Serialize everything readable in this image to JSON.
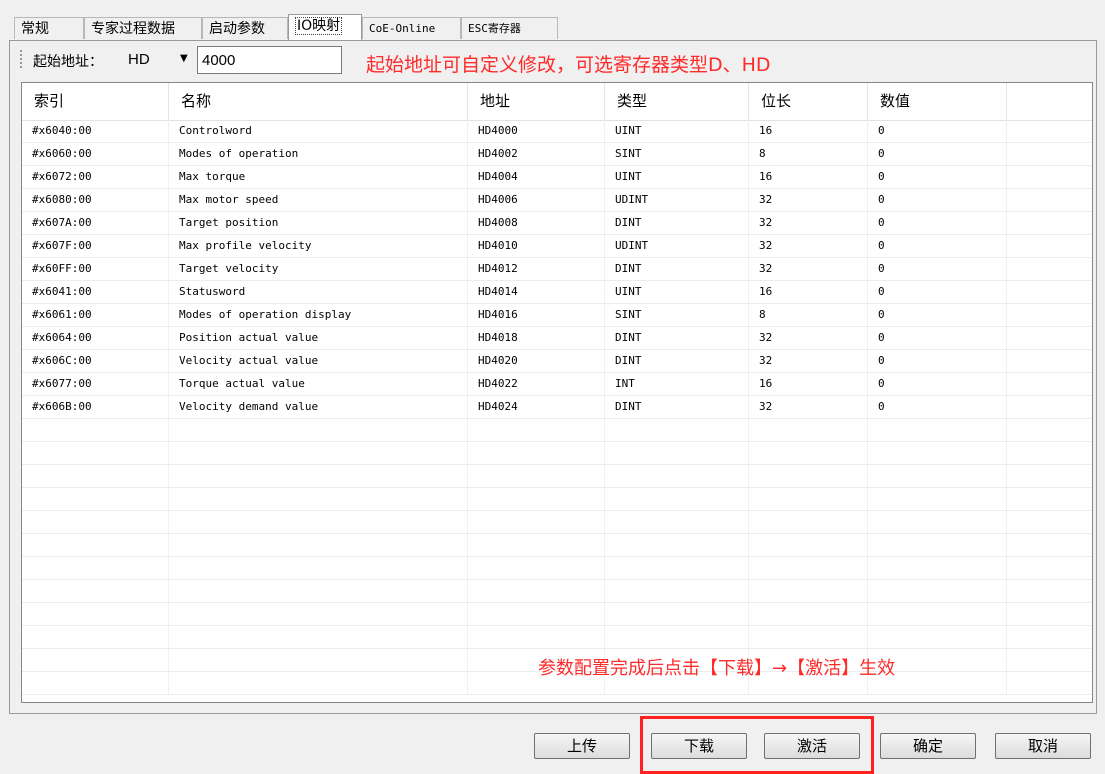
{
  "tabs": [
    {
      "label": "常规"
    },
    {
      "label": "专家过程数据"
    },
    {
      "label": "启动参数"
    },
    {
      "label": "IO映射"
    },
    {
      "label": "CoE-Online"
    },
    {
      "label": "ESC寄存器"
    }
  ],
  "active_tab": "IO映射",
  "toolbar": {
    "start_address_label": "起始地址：",
    "register_type": "HD",
    "start_address_value": "4000"
  },
  "annotations": {
    "top": "起始地址可自定义修改，可选寄存器类型D、HD",
    "bottom": "参数配置完成后点击【下载】→【激活】生效",
    "highlight_color": "#ff2020"
  },
  "table": {
    "columns": [
      "索引",
      "名称",
      "地址",
      "类型",
      "位长",
      "数值"
    ],
    "rows": [
      [
        "#x6040:00",
        "Controlword",
        "HD4000",
        "UINT",
        "16",
        "0"
      ],
      [
        "#x6060:00",
        "Modes of operation",
        "HD4002",
        "SINT",
        "8",
        "0"
      ],
      [
        "#x6072:00",
        "Max torque",
        "HD4004",
        "UINT",
        "16",
        "0"
      ],
      [
        "#x6080:00",
        "Max motor speed",
        "HD4006",
        "UDINT",
        "32",
        "0"
      ],
      [
        "#x607A:00",
        "Target position",
        "HD4008",
        "DINT",
        "32",
        "0"
      ],
      [
        "#x607F:00",
        "Max profile velocity",
        "HD4010",
        "UDINT",
        "32",
        "0"
      ],
      [
        "#x60FF:00",
        "Target velocity",
        "HD4012",
        "DINT",
        "32",
        "0"
      ],
      [
        "#x6041:00",
        "Statusword",
        "HD4014",
        "UINT",
        "16",
        "0"
      ],
      [
        "#x6061:00",
        "Modes of operation display",
        "HD4016",
        "SINT",
        "8",
        "0"
      ],
      [
        "#x6064:00",
        "Position actual value",
        "HD4018",
        "DINT",
        "32",
        "0"
      ],
      [
        "#x606C:00",
        "Velocity actual value",
        "HD4020",
        "DINT",
        "32",
        "0"
      ],
      [
        "#x6077:00",
        "Torque actual value",
        "HD4022",
        "INT",
        "16",
        "0"
      ],
      [
        "#x606B:00",
        "Velocity demand value",
        "HD4024",
        "DINT",
        "32",
        "0"
      ]
    ],
    "empty_rows": 12
  },
  "buttons": {
    "upload": "上传",
    "download": "下载",
    "activate": "激活",
    "ok": "确定",
    "cancel": "取消"
  }
}
